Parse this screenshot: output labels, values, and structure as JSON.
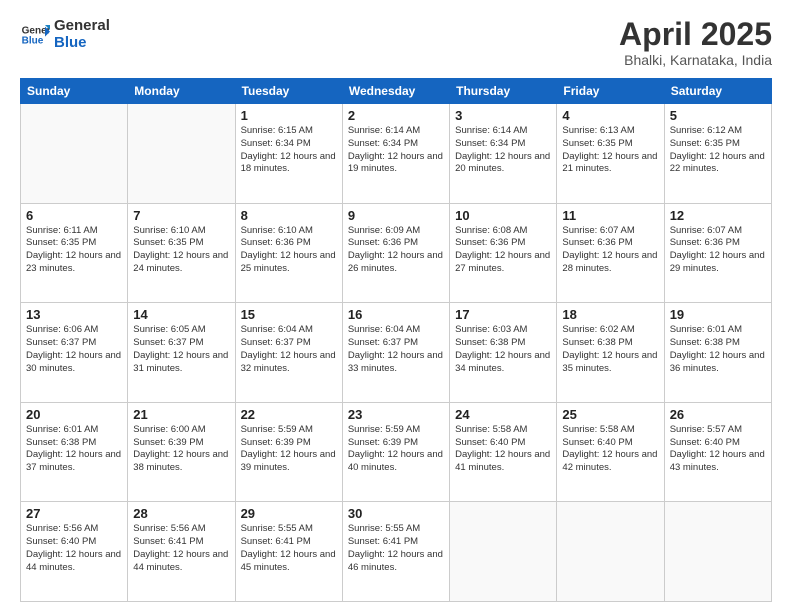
{
  "header": {
    "logo_general": "General",
    "logo_blue": "Blue",
    "month_title": "April 2025",
    "location": "Bhalki, Karnataka, India"
  },
  "days_of_week": [
    "Sunday",
    "Monday",
    "Tuesday",
    "Wednesday",
    "Thursday",
    "Friday",
    "Saturday"
  ],
  "weeks": [
    [
      {
        "day": "",
        "sunrise": "",
        "sunset": "",
        "daylight": ""
      },
      {
        "day": "",
        "sunrise": "",
        "sunset": "",
        "daylight": ""
      },
      {
        "day": "1",
        "sunrise": "Sunrise: 6:15 AM",
        "sunset": "Sunset: 6:34 PM",
        "daylight": "Daylight: 12 hours and 18 minutes."
      },
      {
        "day": "2",
        "sunrise": "Sunrise: 6:14 AM",
        "sunset": "Sunset: 6:34 PM",
        "daylight": "Daylight: 12 hours and 19 minutes."
      },
      {
        "day": "3",
        "sunrise": "Sunrise: 6:14 AM",
        "sunset": "Sunset: 6:34 PM",
        "daylight": "Daylight: 12 hours and 20 minutes."
      },
      {
        "day": "4",
        "sunrise": "Sunrise: 6:13 AM",
        "sunset": "Sunset: 6:35 PM",
        "daylight": "Daylight: 12 hours and 21 minutes."
      },
      {
        "day": "5",
        "sunrise": "Sunrise: 6:12 AM",
        "sunset": "Sunset: 6:35 PM",
        "daylight": "Daylight: 12 hours and 22 minutes."
      }
    ],
    [
      {
        "day": "6",
        "sunrise": "Sunrise: 6:11 AM",
        "sunset": "Sunset: 6:35 PM",
        "daylight": "Daylight: 12 hours and 23 minutes."
      },
      {
        "day": "7",
        "sunrise": "Sunrise: 6:10 AM",
        "sunset": "Sunset: 6:35 PM",
        "daylight": "Daylight: 12 hours and 24 minutes."
      },
      {
        "day": "8",
        "sunrise": "Sunrise: 6:10 AM",
        "sunset": "Sunset: 6:36 PM",
        "daylight": "Daylight: 12 hours and 25 minutes."
      },
      {
        "day": "9",
        "sunrise": "Sunrise: 6:09 AM",
        "sunset": "Sunset: 6:36 PM",
        "daylight": "Daylight: 12 hours and 26 minutes."
      },
      {
        "day": "10",
        "sunrise": "Sunrise: 6:08 AM",
        "sunset": "Sunset: 6:36 PM",
        "daylight": "Daylight: 12 hours and 27 minutes."
      },
      {
        "day": "11",
        "sunrise": "Sunrise: 6:07 AM",
        "sunset": "Sunset: 6:36 PM",
        "daylight": "Daylight: 12 hours and 28 minutes."
      },
      {
        "day": "12",
        "sunrise": "Sunrise: 6:07 AM",
        "sunset": "Sunset: 6:36 PM",
        "daylight": "Daylight: 12 hours and 29 minutes."
      }
    ],
    [
      {
        "day": "13",
        "sunrise": "Sunrise: 6:06 AM",
        "sunset": "Sunset: 6:37 PM",
        "daylight": "Daylight: 12 hours and 30 minutes."
      },
      {
        "day": "14",
        "sunrise": "Sunrise: 6:05 AM",
        "sunset": "Sunset: 6:37 PM",
        "daylight": "Daylight: 12 hours and 31 minutes."
      },
      {
        "day": "15",
        "sunrise": "Sunrise: 6:04 AM",
        "sunset": "Sunset: 6:37 PM",
        "daylight": "Daylight: 12 hours and 32 minutes."
      },
      {
        "day": "16",
        "sunrise": "Sunrise: 6:04 AM",
        "sunset": "Sunset: 6:37 PM",
        "daylight": "Daylight: 12 hours and 33 minutes."
      },
      {
        "day": "17",
        "sunrise": "Sunrise: 6:03 AM",
        "sunset": "Sunset: 6:38 PM",
        "daylight": "Daylight: 12 hours and 34 minutes."
      },
      {
        "day": "18",
        "sunrise": "Sunrise: 6:02 AM",
        "sunset": "Sunset: 6:38 PM",
        "daylight": "Daylight: 12 hours and 35 minutes."
      },
      {
        "day": "19",
        "sunrise": "Sunrise: 6:01 AM",
        "sunset": "Sunset: 6:38 PM",
        "daylight": "Daylight: 12 hours and 36 minutes."
      }
    ],
    [
      {
        "day": "20",
        "sunrise": "Sunrise: 6:01 AM",
        "sunset": "Sunset: 6:38 PM",
        "daylight": "Daylight: 12 hours and 37 minutes."
      },
      {
        "day": "21",
        "sunrise": "Sunrise: 6:00 AM",
        "sunset": "Sunset: 6:39 PM",
        "daylight": "Daylight: 12 hours and 38 minutes."
      },
      {
        "day": "22",
        "sunrise": "Sunrise: 5:59 AM",
        "sunset": "Sunset: 6:39 PM",
        "daylight": "Daylight: 12 hours and 39 minutes."
      },
      {
        "day": "23",
        "sunrise": "Sunrise: 5:59 AM",
        "sunset": "Sunset: 6:39 PM",
        "daylight": "Daylight: 12 hours and 40 minutes."
      },
      {
        "day": "24",
        "sunrise": "Sunrise: 5:58 AM",
        "sunset": "Sunset: 6:40 PM",
        "daylight": "Daylight: 12 hours and 41 minutes."
      },
      {
        "day": "25",
        "sunrise": "Sunrise: 5:58 AM",
        "sunset": "Sunset: 6:40 PM",
        "daylight": "Daylight: 12 hours and 42 minutes."
      },
      {
        "day": "26",
        "sunrise": "Sunrise: 5:57 AM",
        "sunset": "Sunset: 6:40 PM",
        "daylight": "Daylight: 12 hours and 43 minutes."
      }
    ],
    [
      {
        "day": "27",
        "sunrise": "Sunrise: 5:56 AM",
        "sunset": "Sunset: 6:40 PM",
        "daylight": "Daylight: 12 hours and 44 minutes."
      },
      {
        "day": "28",
        "sunrise": "Sunrise: 5:56 AM",
        "sunset": "Sunset: 6:41 PM",
        "daylight": "Daylight: 12 hours and 44 minutes."
      },
      {
        "day": "29",
        "sunrise": "Sunrise: 5:55 AM",
        "sunset": "Sunset: 6:41 PM",
        "daylight": "Daylight: 12 hours and 45 minutes."
      },
      {
        "day": "30",
        "sunrise": "Sunrise: 5:55 AM",
        "sunset": "Sunset: 6:41 PM",
        "daylight": "Daylight: 12 hours and 46 minutes."
      },
      {
        "day": "",
        "sunrise": "",
        "sunset": "",
        "daylight": ""
      },
      {
        "day": "",
        "sunrise": "",
        "sunset": "",
        "daylight": ""
      },
      {
        "day": "",
        "sunrise": "",
        "sunset": "",
        "daylight": ""
      }
    ]
  ]
}
